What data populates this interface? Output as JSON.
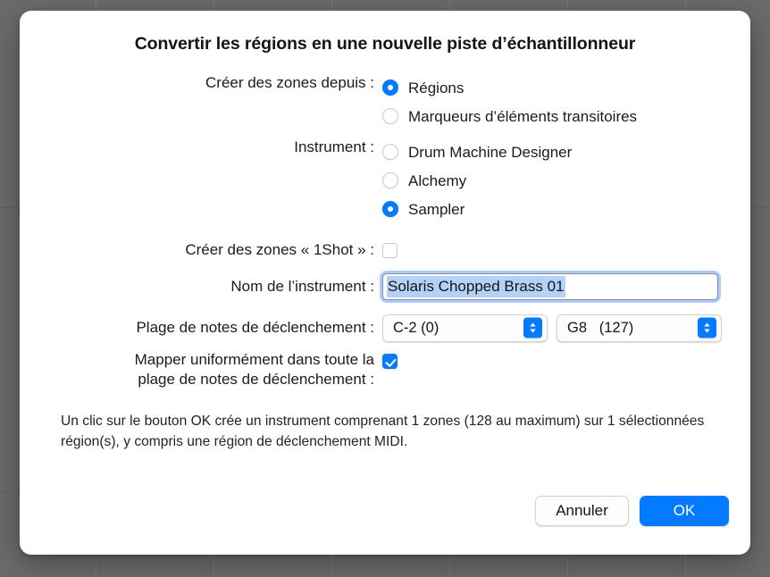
{
  "dialog": {
    "title": "Convertir les régions en une nouvelle piste d’échantillonneur",
    "accent_color": "#047aff",
    "background_color": "#6b6b6b",
    "surface_color": "#ffffff"
  },
  "fields": {
    "create_zones_from": {
      "label": "Créer des zones depuis :",
      "options": [
        {
          "label": "Régions",
          "selected": true
        },
        {
          "label": "Marqueurs d’éléments transitoires",
          "selected": false
        }
      ]
    },
    "instrument": {
      "label": "Instrument :",
      "options": [
        {
          "label": "Drum Machine Designer",
          "selected": false
        },
        {
          "label": "Alchemy",
          "selected": false
        },
        {
          "label": "Sampler",
          "selected": true
        }
      ]
    },
    "one_shot": {
      "label": "Créer des zones « 1Shot » :",
      "checked": false
    },
    "instrument_name": {
      "label": "Nom de l’instrument :",
      "value": "Solaris Chopped Brass 01",
      "selected": true
    },
    "trigger_note_range": {
      "label": "Plage de notes de déclenchement :",
      "low": "C-2 (0)",
      "high": "G8   (127)"
    },
    "map_uniformly": {
      "label": "Mapper uniformément dans toute la\nplage de notes de déclenchement :",
      "checked": true
    }
  },
  "description": "Un clic sur le bouton OK crée un instrument comprenant 1 zones (128 au maximum) sur 1 sélectionnées région(s), y compris une région de déclenchement MIDI.",
  "footer": {
    "cancel_label": "Annuler",
    "ok_label": "OK"
  }
}
